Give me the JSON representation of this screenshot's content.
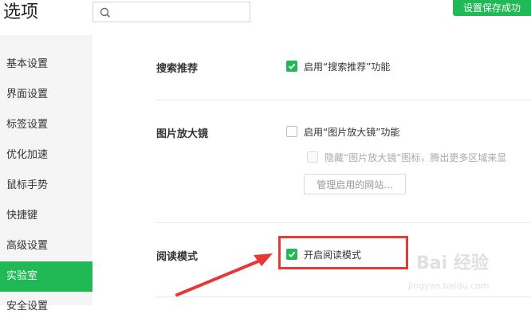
{
  "header": {
    "title": "选项",
    "search_placeholder": "",
    "save_status": "设置保存成功"
  },
  "sidebar": {
    "items": [
      {
        "label": "基本设置"
      },
      {
        "label": "界面设置"
      },
      {
        "label": "标签设置"
      },
      {
        "label": "优化加速"
      },
      {
        "label": "鼠标手势"
      },
      {
        "label": "快捷键"
      },
      {
        "label": "高级设置"
      },
      {
        "label": "实验室",
        "active": true
      },
      {
        "label": "安全设置"
      }
    ]
  },
  "sections": {
    "search_recommend": {
      "label": "搜索推荐",
      "option_label": "启用“搜索推荐”功能",
      "checked": true
    },
    "image_magnifier": {
      "label": "图片放大镜",
      "option_label": "启用“图片放大镜”功能",
      "checked": false,
      "sub_option_label": "隐藏“图片放大镜”图标，腾出更多区域来显",
      "sub_checked": false,
      "manage_button": "管理启用的网站..."
    },
    "reading_mode": {
      "label": "阅读模式",
      "option_label": "开启阅读模式",
      "checked": true
    }
  },
  "annotation": {
    "highlight_color": "#e53935"
  },
  "watermark": {
    "brand": "Bai 经验",
    "url": "jingyan.baidu.com"
  },
  "colors": {
    "accent": "#21b956",
    "sidebar_bg": "#f5f5f5"
  }
}
